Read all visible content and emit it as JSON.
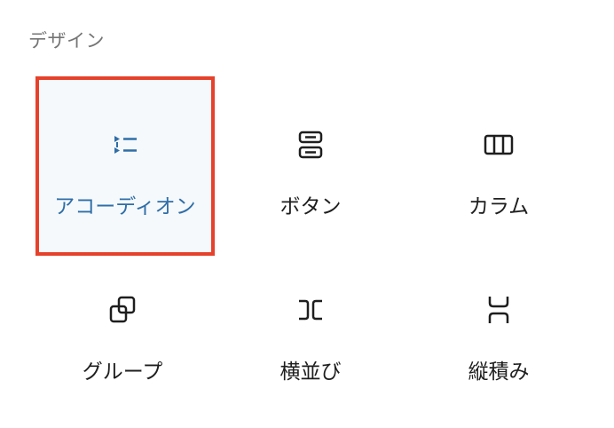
{
  "category": {
    "title": "デザイン"
  },
  "blocks": [
    {
      "label": "アコーディオン",
      "icon": "accordion-icon",
      "selected": true
    },
    {
      "label": "ボタン",
      "icon": "buttons-icon",
      "selected": false
    },
    {
      "label": "カラム",
      "icon": "columns-icon",
      "selected": false
    },
    {
      "label": "グループ",
      "icon": "group-icon",
      "selected": false
    },
    {
      "label": "横並び",
      "icon": "row-icon",
      "selected": false
    },
    {
      "label": "縦積み",
      "icon": "stack-icon",
      "selected": false
    }
  ],
  "colors": {
    "selected_border": "#e6412b",
    "selected_background": "#f5f9fc",
    "selected_accent": "#2f6ea7",
    "text": "#1e1e1e",
    "category_text": "#757575"
  }
}
